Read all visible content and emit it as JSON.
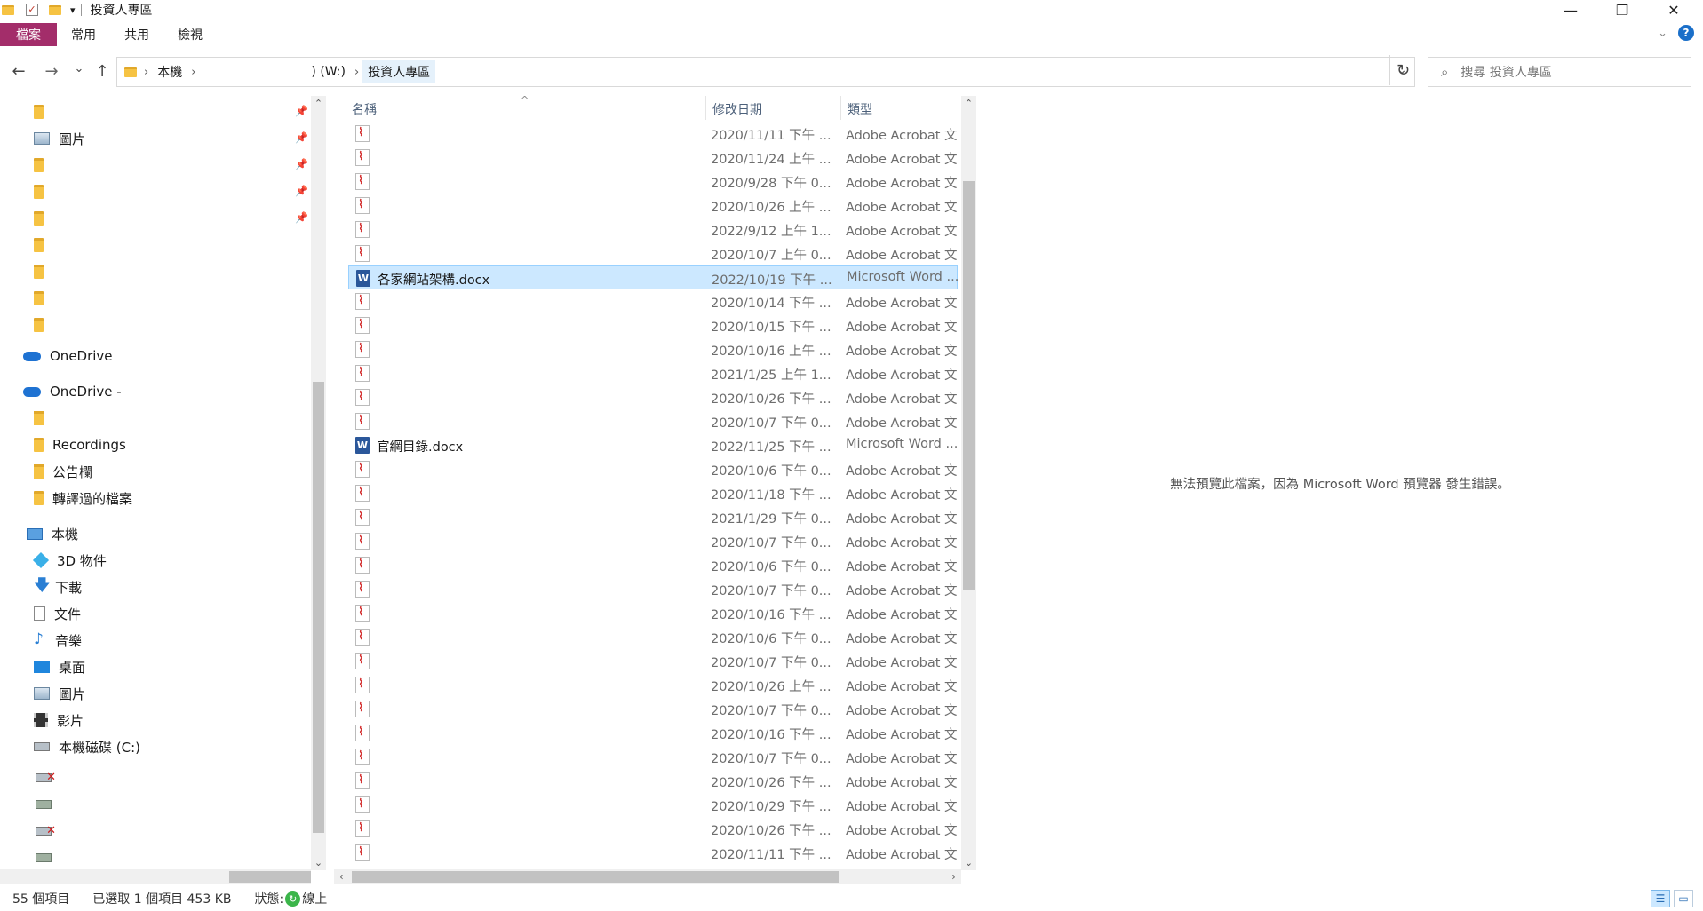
{
  "window": {
    "title": "投資人專區",
    "minimize": "—",
    "restore": "❐",
    "close": "✕"
  },
  "ribbon": {
    "tabs": [
      "檔案",
      "常用",
      "共用",
      "檢視"
    ],
    "expand_icon": "chevron-down-icon",
    "help": "?"
  },
  "nav": {
    "back": "←",
    "forward": "→",
    "recent": "⌄",
    "up": "↑"
  },
  "address": {
    "crumbs": [
      "本機",
      ") (W:)",
      "投資人專區"
    ],
    "dropdown": "⌄",
    "refresh": "↻"
  },
  "search": {
    "placeholder": "搜尋 投資人專區"
  },
  "sidebar": {
    "quick_access": [
      {
        "label": "",
        "icon": "folder-icon"
      },
      {
        "label": "圖片",
        "icon": "pictures-icon"
      },
      {
        "label": "",
        "icon": "folder-icon"
      },
      {
        "label": "",
        "icon": "folder-icon"
      },
      {
        "label": "",
        "icon": "folder-icon"
      },
      {
        "label": "",
        "icon": "folder-icon"
      },
      {
        "label": "",
        "icon": "folder-icon"
      },
      {
        "label": "",
        "icon": "folder-icon"
      },
      {
        "label": "",
        "icon": "folder-icon"
      }
    ],
    "onedrive1": "OneDrive",
    "onedrive2": "OneDrive -",
    "onedrive_children": [
      {
        "label": "",
        "icon": "shared-folder-icon"
      },
      {
        "label": "Recordings",
        "icon": "folder-icon"
      },
      {
        "label": "公告欄",
        "icon": "shared-folder-icon"
      },
      {
        "label": "轉譯過的檔案",
        "icon": "folder-icon"
      }
    ],
    "this_pc": "本機",
    "pc_children": [
      {
        "label": "3D 物件",
        "icon": "3d-objects-icon"
      },
      {
        "label": "下載",
        "icon": "downloads-icon"
      },
      {
        "label": "文件",
        "icon": "documents-icon"
      },
      {
        "label": "音樂",
        "icon": "music-icon"
      },
      {
        "label": "桌面",
        "icon": "desktop-icon"
      },
      {
        "label": "圖片",
        "icon": "pictures-icon"
      },
      {
        "label": "影片",
        "icon": "videos-icon"
      },
      {
        "label": "本機磁碟 (C:)",
        "icon": "local-disk-icon"
      }
    ]
  },
  "filelist": {
    "headers": {
      "name": "名稱",
      "date": "修改日期",
      "type": "類型"
    },
    "rows": [
      {
        "name": "",
        "date": "2020/11/11 下午 ...",
        "type": "Adobe Acrobat 文...",
        "kind": "pdf"
      },
      {
        "name": "",
        "date": "2020/11/24 上午 ...",
        "type": "Adobe Acrobat 文...",
        "kind": "pdf"
      },
      {
        "name": "",
        "date": "2020/9/28 下午 0...",
        "type": "Adobe Acrobat 文...",
        "kind": "pdf"
      },
      {
        "name": "",
        "date": "2020/10/26 上午 ...",
        "type": "Adobe Acrobat 文...",
        "kind": "pdf"
      },
      {
        "name": "",
        "date": "2022/9/12 上午 1...",
        "type": "Adobe Acrobat 文...",
        "kind": "pdf"
      },
      {
        "name": "",
        "date": "2020/10/7 上午 0...",
        "type": "Adobe Acrobat 文...",
        "kind": "pdf"
      },
      {
        "name": "各家網站架構.docx",
        "date": "2022/10/19 下午 ...",
        "type": "Microsoft Word ...",
        "kind": "word",
        "selected": true
      },
      {
        "name": "",
        "date": "2020/10/14 下午 ...",
        "type": "Adobe Acrobat 文...",
        "kind": "pdf"
      },
      {
        "name": "",
        "date": "2020/10/15 下午 ...",
        "type": "Adobe Acrobat 文...",
        "kind": "pdf"
      },
      {
        "name": "",
        "date": "2020/10/16 上午 ...",
        "type": "Adobe Acrobat 文...",
        "kind": "pdf"
      },
      {
        "name": "",
        "date": "2021/1/25 上午 1...",
        "type": "Adobe Acrobat 文...",
        "kind": "pdf"
      },
      {
        "name": "",
        "date": "2020/10/26 下午 ...",
        "type": "Adobe Acrobat 文...",
        "kind": "pdf"
      },
      {
        "name": "",
        "date": "2020/10/7 下午 0...",
        "type": "Adobe Acrobat 文...",
        "kind": "pdf"
      },
      {
        "name": "官網目錄.docx",
        "date": "2022/11/25 下午 ...",
        "type": "Microsoft Word ...",
        "kind": "word"
      },
      {
        "name": "",
        "date": "2020/10/6 下午 0...",
        "type": "Adobe Acrobat 文...",
        "kind": "pdf"
      },
      {
        "name": "",
        "date": "2020/11/18 下午 ...",
        "type": "Adobe Acrobat 文...",
        "kind": "pdf"
      },
      {
        "name": "",
        "date": "2021/1/29 下午 0...",
        "type": "Adobe Acrobat 文...",
        "kind": "pdf"
      },
      {
        "name": "",
        "date": "2020/10/7 下午 0...",
        "type": "Adobe Acrobat 文...",
        "kind": "pdf"
      },
      {
        "name": "",
        "date": "2020/10/6 下午 0...",
        "type": "Adobe Acrobat 文...",
        "kind": "pdf"
      },
      {
        "name": "",
        "date": "2020/10/7 下午 0...",
        "type": "Adobe Acrobat 文...",
        "kind": "pdf"
      },
      {
        "name": "",
        "date": "2020/10/16 下午 ...",
        "type": "Adobe Acrobat 文...",
        "kind": "pdf"
      },
      {
        "name": "",
        "date": "2020/10/6 下午 0...",
        "type": "Adobe Acrobat 文...",
        "kind": "pdf"
      },
      {
        "name": "",
        "date": "2020/10/7 下午 0...",
        "type": "Adobe Acrobat 文...",
        "kind": "pdf"
      },
      {
        "name": "",
        "date": "2020/10/26 上午 ...",
        "type": "Adobe Acrobat 文...",
        "kind": "pdf"
      },
      {
        "name": "",
        "date": "2020/10/7 下午 0...",
        "type": "Adobe Acrobat 文...",
        "kind": "pdf"
      },
      {
        "name": "",
        "date": "2020/10/16 下午 ...",
        "type": "Adobe Acrobat 文...",
        "kind": "pdf"
      },
      {
        "name": "",
        "date": "2020/10/7 下午 0...",
        "type": "Adobe Acrobat 文...",
        "kind": "pdf"
      },
      {
        "name": "",
        "date": "2020/10/26 下午 ...",
        "type": "Adobe Acrobat 文...",
        "kind": "pdf"
      },
      {
        "name": "",
        "date": "2020/10/29 下午 ...",
        "type": "Adobe Acrobat 文...",
        "kind": "pdf"
      },
      {
        "name": "",
        "date": "2020/10/26 下午 ...",
        "type": "Adobe Acrobat 文...",
        "kind": "pdf"
      },
      {
        "name": "",
        "date": "2020/11/11 下午 ...",
        "type": "Adobe Acrobat 文...",
        "kind": "pdf"
      }
    ]
  },
  "preview": {
    "message": "無法預覽此檔案，因為 Microsoft Word 預覽器 發生錯誤。"
  },
  "status": {
    "count": "55 個項目",
    "selected": "已選取 1 個項目  453 KB",
    "state_label": "狀態:",
    "state_value": "線上"
  }
}
